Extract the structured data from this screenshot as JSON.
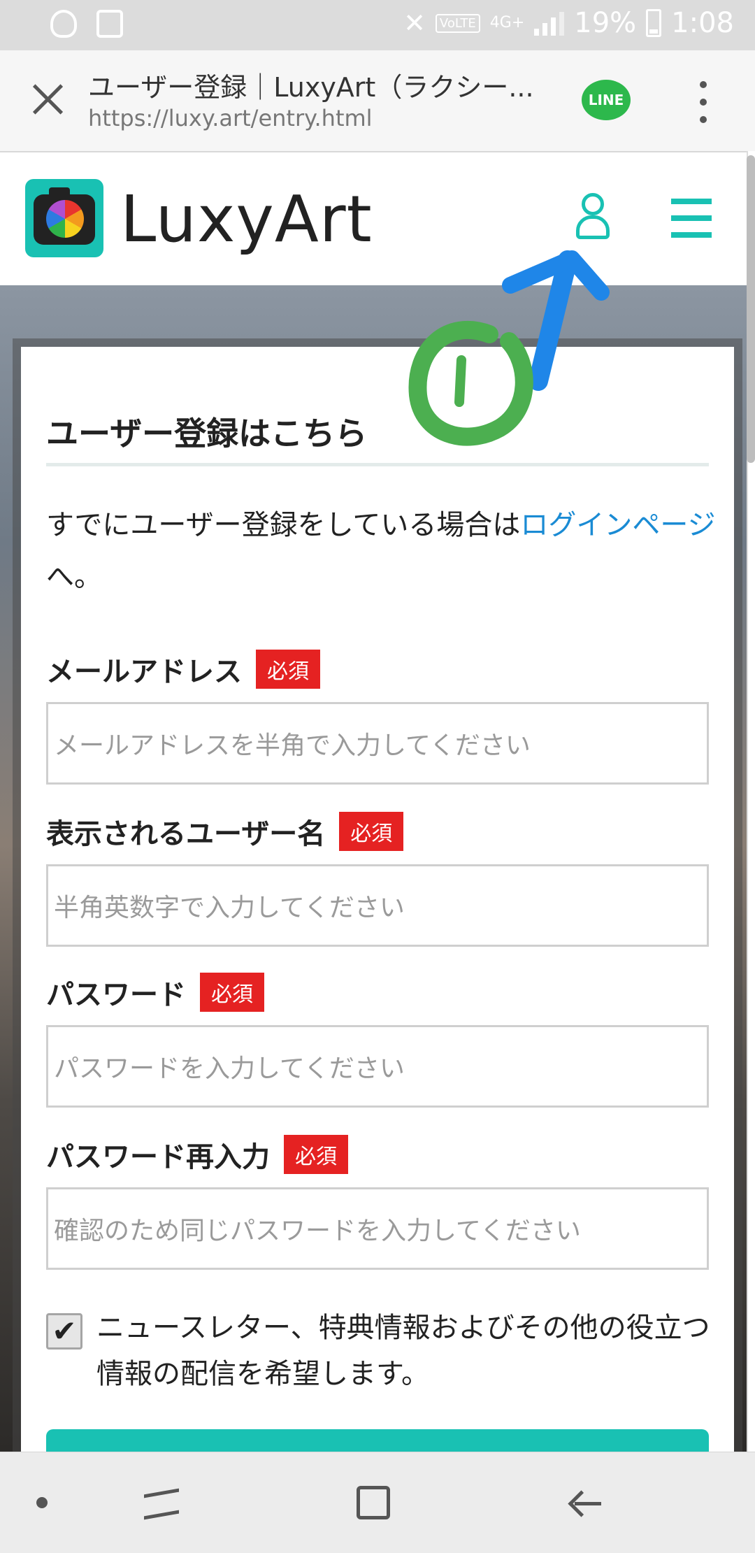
{
  "status_bar": {
    "network": "4G+",
    "volte": "VoLTE",
    "battery": "19%",
    "time": "1:08"
  },
  "browser": {
    "title": "ユーザー登録｜LuxyArt（ラクシー...",
    "url": "https://luxy.art/entry.html",
    "share_badge": "LINE"
  },
  "site": {
    "logo_text": "LuxyArt"
  },
  "form": {
    "heading": "ユーザー登録はこちら",
    "intro_text": "すでにユーザー登録をしている場合は",
    "intro_link": "ログインページ",
    "intro_suffix": "へ。",
    "required_label": "必須",
    "fields": [
      {
        "label": "メールアドレス",
        "placeholder": "メールアドレスを半角で入力してください"
      },
      {
        "label": "表示されるユーザー名",
        "placeholder": "半角英数字で入力してください"
      },
      {
        "label": "パスワード",
        "placeholder": "パスワードを入力してください"
      },
      {
        "label": "パスワード再入力",
        "placeholder": "確認のため同じパスワードを入力してください"
      }
    ],
    "newsletter_checked": true,
    "newsletter_text": "ニュースレター、特典情報およびその他の役立つ情報の配信を希望します。"
  },
  "colors": {
    "brand": "#19c1b3",
    "required": "#e52222",
    "link": "#1a8bd4",
    "annotation_blue": "#1f86e8",
    "annotation_green": "#4caf50"
  },
  "icons": [
    "shield-icon",
    "clipboard-icon",
    "mute-icon",
    "signal-icon",
    "battery-icon",
    "close-icon",
    "line-icon",
    "kebab-menu-icon",
    "user-icon",
    "hamburger-menu-icon",
    "checkmark-icon",
    "recent-apps-icon",
    "home-icon",
    "back-icon"
  ]
}
